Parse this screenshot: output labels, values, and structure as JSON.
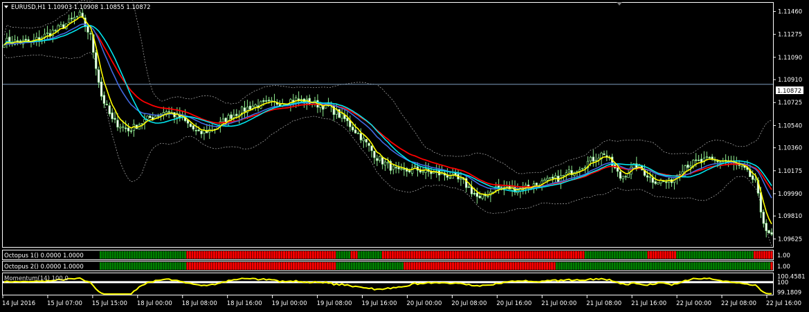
{
  "header": {
    "symbol_title": "EURUSD,H1  1.10903 1.10908 1.10855 1.10872"
  },
  "colors": {
    "background": "#000000",
    "frame": "#ffffff",
    "bull": "#90ee90",
    "bear": "#ffffff",
    "ma_red": "#ff0000",
    "ma_blue": "#4169e1",
    "ma_cyan": "#00e5ee",
    "ma_yellow": "#ffff00",
    "bands": "#a0a0a0",
    "price_line": "#7f9fbf",
    "heat_red": "#ff0000",
    "heat_green": "#008000"
  },
  "chart_data": [
    {
      "type": "candlestick",
      "symbol": "EURUSD",
      "timeframe": "H1",
      "ohlc_header": {
        "open": 1.10903,
        "high": 1.10908,
        "low": 1.10855,
        "close": 1.10872
      },
      "current_price": 1.10872,
      "ylim": [
        1.0956,
        1.1153
      ],
      "y_ticks": [
        1.1146,
        1.11275,
        1.1109,
        1.1091,
        1.10725,
        1.1054,
        1.1036,
        1.10175,
        1.0999,
        1.0981,
        1.09625
      ],
      "y_tick_labels": [
        "1.11460",
        "1.11275",
        "1.11090",
        "1.10910",
        "1.10725",
        "1.10540",
        "1.10360",
        "1.10175",
        "1.09990",
        "1.09810",
        "1.09625"
      ],
      "x_tick_labels": [
        "14 Jul 2016",
        "15 Jul 07:00",
        "15 Jul 15:00",
        "18 Jul 00:00",
        "18 Jul 08:00",
        "18 Jul 16:00",
        "19 Jul 00:00",
        "19 Jul 08:00",
        "19 Jul 16:00",
        "20 Jul 00:00",
        "20 Jul 08:00",
        "20 Jul 16:00",
        "21 Jul 00:00",
        "21 Jul 08:00",
        "21 Jul 16:00",
        "22 Jul 00:00",
        "22 Jul 08:00",
        "22 Jul 16:00"
      ],
      "close_anchors": [
        [
          0,
          1.1122
        ],
        [
          10,
          1.1121
        ],
        [
          20,
          1.1132
        ],
        [
          28,
          1.1143
        ],
        [
          32,
          1.1126
        ],
        [
          36,
          1.1078
        ],
        [
          40,
          1.1058
        ],
        [
          46,
          1.105
        ],
        [
          52,
          1.1058
        ],
        [
          60,
          1.1066
        ],
        [
          66,
          1.1059
        ],
        [
          72,
          1.1047
        ],
        [
          78,
          1.1052
        ],
        [
          84,
          1.1062
        ],
        [
          92,
          1.107
        ],
        [
          100,
          1.1072
        ],
        [
          108,
          1.1075
        ],
        [
          114,
          1.1072
        ],
        [
          120,
          1.1069
        ],
        [
          126,
          1.1059
        ],
        [
          132,
          1.1045
        ],
        [
          138,
          1.1028
        ],
        [
          146,
          1.1016
        ],
        [
          152,
          1.1019
        ],
        [
          158,
          1.1016
        ],
        [
          164,
          1.1014
        ],
        [
          170,
          1.1008
        ],
        [
          176,
          1.0994
        ],
        [
          182,
          1.1004
        ],
        [
          190,
          1.1003
        ],
        [
          198,
          1.1007
        ],
        [
          206,
          1.1012
        ],
        [
          214,
          1.1022
        ],
        [
          222,
          1.1032
        ],
        [
          228,
          1.1012
        ],
        [
          234,
          1.1022
        ],
        [
          240,
          1.101
        ],
        [
          246,
          1.1008
        ],
        [
          252,
          1.1022
        ],
        [
          260,
          1.1026
        ],
        [
          268,
          1.1025
        ],
        [
          274,
          1.1018
        ],
        [
          278,
          1.1008
        ],
        [
          280,
          1.0985
        ],
        [
          282,
          1.097
        ],
        [
          283,
          1.0965
        ]
      ],
      "series_color_keys": [
        "ma_red",
        "ma_blue",
        "ma_cyan",
        "ma_yellow",
        "bands"
      ]
    },
    {
      "type": "heatmap",
      "name": "Octopus 1",
      "label": "Octopus 1() 0.0000 1.0000",
      "ylim": [
        0,
        1
      ],
      "axis_label": "1.00",
      "state_runs": [
        [
          "G",
          36
        ],
        [
          "R",
          62
        ],
        [
          "G",
          6
        ],
        [
          "R",
          3
        ],
        [
          "G",
          10
        ],
        [
          "R",
          84
        ],
        [
          "G",
          26
        ],
        [
          "R",
          12
        ],
        [
          "G",
          32
        ],
        [
          "R",
          8
        ]
      ]
    },
    {
      "type": "heatmap",
      "name": "Octopus 2",
      "label": "Octopus 2() 0.0000 1.0000",
      "ylim": [
        0,
        1
      ],
      "axis_label": "1.00",
      "state_runs": [
        [
          "G",
          36
        ],
        [
          "R",
          62
        ],
        [
          "G",
          28
        ],
        [
          "R",
          63
        ],
        [
          "G",
          89
        ],
        [
          "R",
          1
        ]
      ]
    },
    {
      "type": "line",
      "label_text": "Momentum(14) 100.0",
      "y_ticks": [
        100.4581,
        100,
        99.1809
      ],
      "y_tick_labels": [
        "100.4581",
        "100",
        "99.1809"
      ],
      "ylim": [
        99.05,
        100.6
      ],
      "reference_level": 100,
      "series_color_key": "ma_yellow"
    }
  ]
}
